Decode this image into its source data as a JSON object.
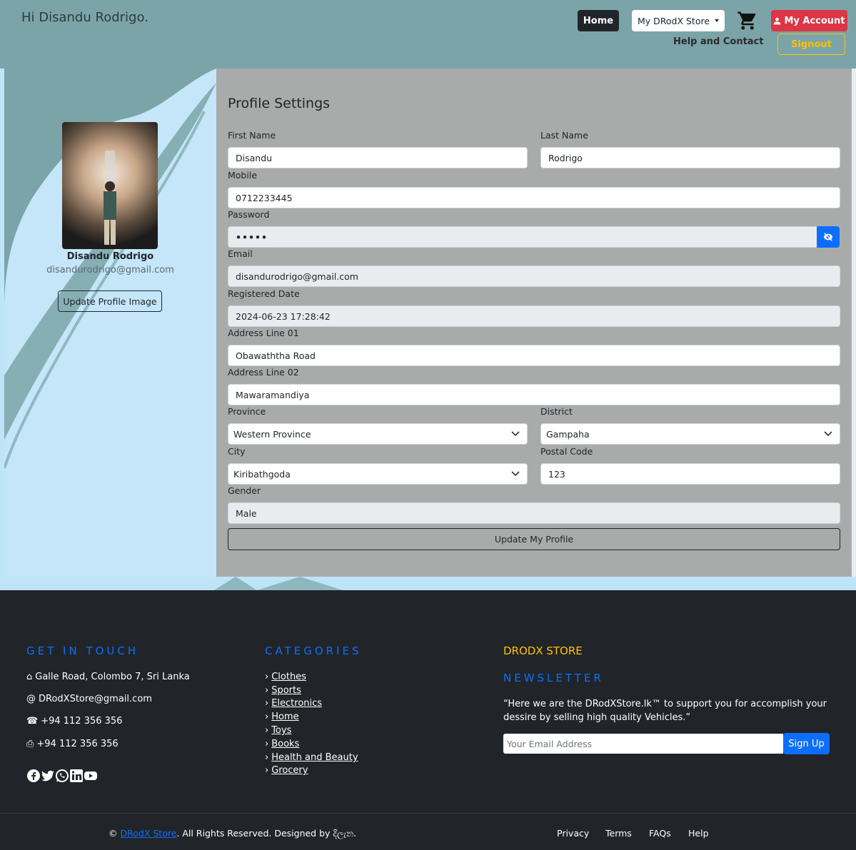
{
  "header": {
    "greeting": "Hi Disandu Rodrigo.",
    "home_label": "Home",
    "store_label": "My DRodX Store",
    "account_label": "My Account",
    "help_label": "Help and Contact",
    "signout_label": "Signout"
  },
  "profile": {
    "name": "Disandu Rodrigo",
    "email": "disandurodrigo@gmail.com",
    "update_image_label": "Update Profile Image"
  },
  "settings": {
    "title": "Profile Settings",
    "first_name_label": "First Name",
    "first_name": "Disandu",
    "last_name_label": "Last Name",
    "last_name": "Rodrigo",
    "mobile_label": "Mobile",
    "mobile": "0712233445",
    "password_label": "Password",
    "password": "•••••",
    "email_label": "Email",
    "email": "disandurodrigo@gmail.com",
    "registered_label": "Registered Date",
    "registered": "2024-06-23 17:28:42",
    "address1_label": "Address Line 01",
    "address1": "Obawaththa Road",
    "address2_label": "Address Line 02",
    "address2": "Mawaramandiya",
    "province_label": "Province",
    "province": "Western Province",
    "district_label": "District",
    "district": "Gampaha",
    "city_label": "City",
    "city": "Kiribathgoda",
    "postal_label": "Postal Code",
    "postal": "123",
    "gender_label": "Gender",
    "gender": "Male",
    "update_label": "Update My Profile"
  },
  "footer": {
    "contact_heading": "GET IN TOUCH",
    "address": "Galle Road, Colombo 7, Sri Lanka",
    "email": "DRodXStore@gmail.com",
    "phone": "+94 112 356 356",
    "fax": "+94 112 356 356",
    "categories_heading": "CATEGORIES",
    "categories": [
      "Clothes",
      "Sports",
      "Electronics",
      "Home",
      "Toys",
      "Books",
      "Health and Beauty",
      "Grocery"
    ],
    "store_heading": "DRODX STORE",
    "newsletter_heading": "NEWSLETTER",
    "newsletter_text": "“Here we are the DRodXStore.lk™ to support you for accomplish your dessire by selling high quality Vehicles.”",
    "email_placeholder": "Your Email Address",
    "signup_label": "Sign Up",
    "copyright_prefix": "©",
    "brand": "DRodX Store",
    "copyright_suffix": ". All Rights Reserved. Designed by",
    "designer": "දිලැන.",
    "links": [
      "Privacy",
      "Terms",
      "FAQs",
      "Help"
    ]
  },
  "colors": {
    "header_bg": "#7ba4a8",
    "accent_blue": "#0d6efd",
    "danger": "#dc3545",
    "warning": "#ffc107",
    "footer_bg": "#212529"
  }
}
